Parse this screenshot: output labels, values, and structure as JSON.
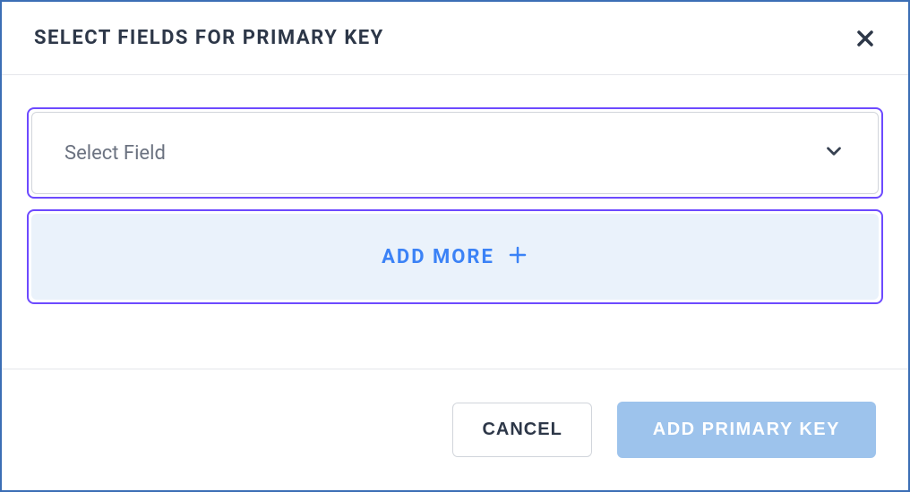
{
  "modal": {
    "title": "SELECT FIELDS FOR PRIMARY KEY",
    "select": {
      "placeholder": "Select Field"
    },
    "addMore": {
      "label": "ADD MORE"
    },
    "footer": {
      "cancel": "CANCEL",
      "confirm": "ADD PRIMARY KEY"
    }
  }
}
